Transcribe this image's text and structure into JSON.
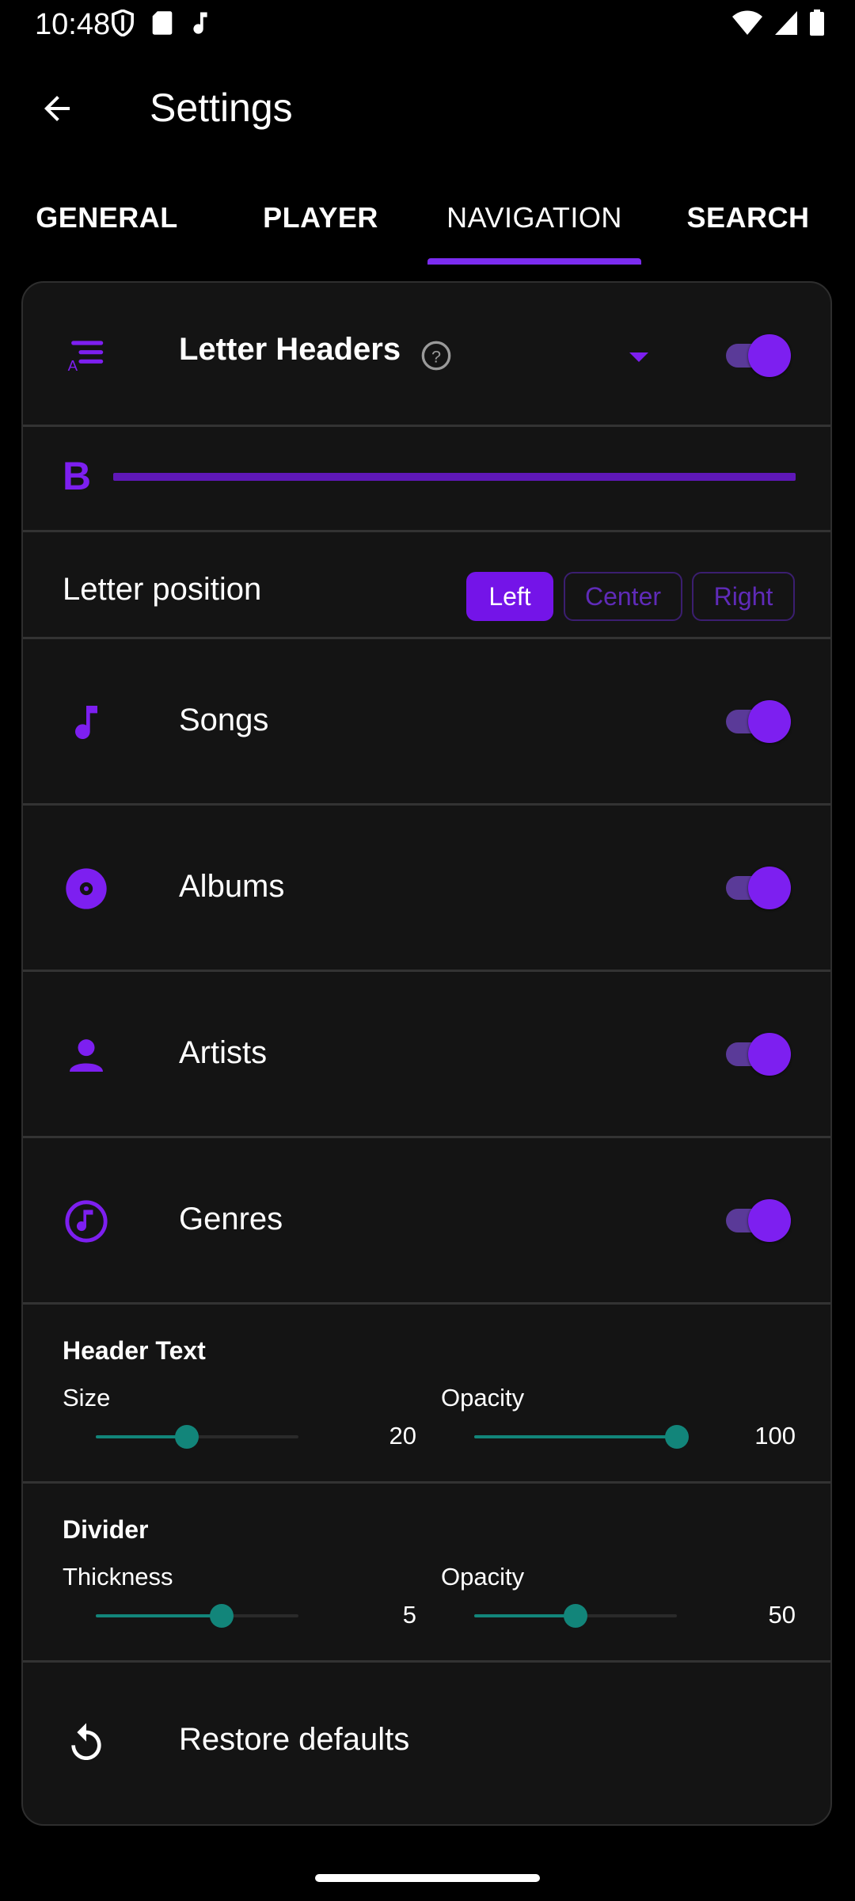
{
  "status_bar": {
    "time": "10:48"
  },
  "app_bar": {
    "title": "Settings"
  },
  "tabs": [
    {
      "label": "GENERAL",
      "active": false
    },
    {
      "label": "PLAYER",
      "active": false
    },
    {
      "label": "NAVIGATION",
      "active": true
    },
    {
      "label": "SEARCH",
      "active": false
    }
  ],
  "letter_headers": {
    "label": "Letter Headers",
    "enabled": true,
    "preview_letter": "B"
  },
  "letter_position": {
    "label": "Letter position",
    "options": [
      "Left",
      "Center",
      "Right"
    ],
    "selected": "Left"
  },
  "nav_items": [
    {
      "label": "Songs",
      "icon": "music-note-icon",
      "enabled": true
    },
    {
      "label": "Albums",
      "icon": "album-disc-icon",
      "enabled": true
    },
    {
      "label": "Artists",
      "icon": "person-icon",
      "enabled": true
    },
    {
      "label": "Genres",
      "icon": "genre-music-circle-icon",
      "enabled": true
    }
  ],
  "header_text": {
    "title": "Header Text",
    "size": {
      "label": "Size",
      "value": "20",
      "fraction": 0.45
    },
    "opacity": {
      "label": "Opacity",
      "value": "100",
      "fraction": 1.0
    }
  },
  "divider": {
    "title": "Divider",
    "thickness": {
      "label": "Thickness",
      "value": "5",
      "fraction": 0.62
    },
    "opacity": {
      "label": "Opacity",
      "value": "50",
      "fraction": 0.5
    }
  },
  "restore": {
    "label": "Restore defaults",
    "icon": "restore-icon"
  },
  "colors": {
    "accent": "#7d1ff0",
    "slider": "#12857a",
    "background": "#000000",
    "card": "#141414"
  }
}
